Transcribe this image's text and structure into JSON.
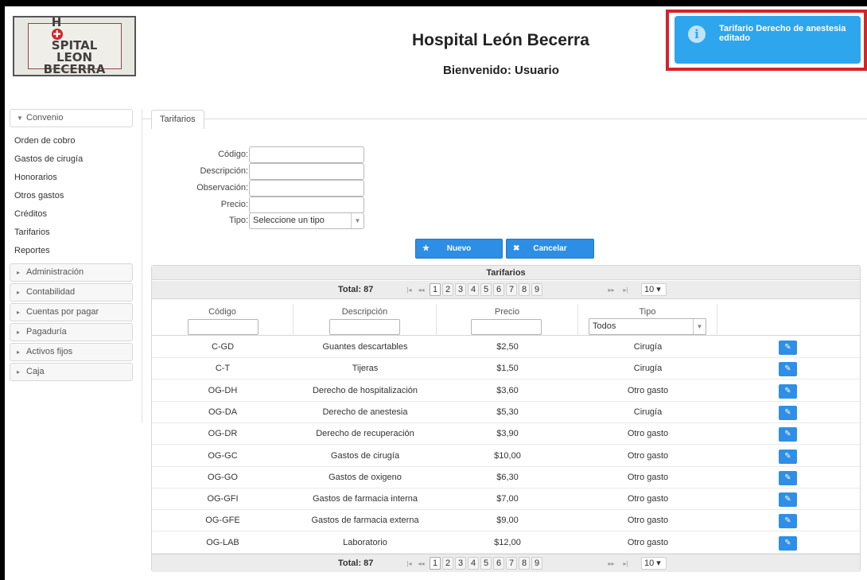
{
  "header": {
    "title": "Hospital León Becerra",
    "subtitle": "Bienvenido: Usuario",
    "logo_line1": "H  SPITAL",
    "logo_line2": "LEON",
    "logo_line3": "BECERRA"
  },
  "toast": {
    "message": "Tarifario Derecho de anestesia editado",
    "icon": "info-icon"
  },
  "sidebar": {
    "open_section": "Convenio",
    "open_items": [
      "Orden de cobro",
      "Gastos de cirugía",
      "Honorarios",
      "Otros gastos",
      "Créditos",
      "Tarifarios",
      "Reportes"
    ],
    "sections": [
      "Administración",
      "Contabilidad",
      "Cuentas por pagar",
      "Pagaduría",
      "Activos fijos",
      "Caja"
    ]
  },
  "tab": {
    "label": "Tarifarios"
  },
  "form": {
    "codigo_label": "Código:",
    "descripcion_label": "Descripción:",
    "observacion_label": "Observación:",
    "precio_label": "Precio:",
    "tipo_label": "Tipo:",
    "tipo_value": "Seleccione un tipo",
    "nuevo_label": "Nuevo",
    "cancelar_label": "Cancelar"
  },
  "grid": {
    "title": "Tarifarios",
    "total": "Total: 87",
    "pages": [
      "1",
      "2",
      "3",
      "4",
      "5",
      "6",
      "7",
      "8",
      "9"
    ],
    "rows_per_page": "10 ▾",
    "columns": [
      "Código",
      "Descripción",
      "Precio",
      "Tipo"
    ],
    "tipo_filter": "Todos",
    "rows": [
      {
        "codigo": "C-GD",
        "descripcion": "Guantes descartables",
        "precio": "$2,50",
        "tipo": "Cirugía"
      },
      {
        "codigo": "C-T",
        "descripcion": "Tijeras",
        "precio": "$1,50",
        "tipo": "Cirugía"
      },
      {
        "codigo": "OG-DH",
        "descripcion": "Derecho de hospitalización",
        "precio": "$3,60",
        "tipo": "Otro gasto"
      },
      {
        "codigo": "OG-DA",
        "descripcion": "Derecho de anestesia",
        "precio": "$5,30",
        "tipo": "Cirugía"
      },
      {
        "codigo": "OG-DR",
        "descripcion": "Derecho de recuperación",
        "precio": "$3,90",
        "tipo": "Otro gasto"
      },
      {
        "codigo": "OG-GC",
        "descripcion": "Gastos de cirugía",
        "precio": "$10,00",
        "tipo": "Otro gasto"
      },
      {
        "codigo": "OG-GO",
        "descripcion": "Gastos de oxigeno",
        "precio": "$6,30",
        "tipo": "Otro gasto"
      },
      {
        "codigo": "OG-GFI",
        "descripcion": "Gastos de farmacia interna",
        "precio": "$7,00",
        "tipo": "Otro gasto"
      },
      {
        "codigo": "OG-GFE",
        "descripcion": "Gastos de farmacia externa",
        "precio": "$9,00",
        "tipo": "Otro gasto"
      },
      {
        "codigo": "OG-LAB",
        "descripcion": "Laboratorio",
        "precio": "$12,00",
        "tipo": "Otro gasto"
      }
    ]
  },
  "colors": {
    "accent": "#2c8ee5",
    "toast_bg": "#2da6ee",
    "highlight_frame": "#d4232b"
  }
}
